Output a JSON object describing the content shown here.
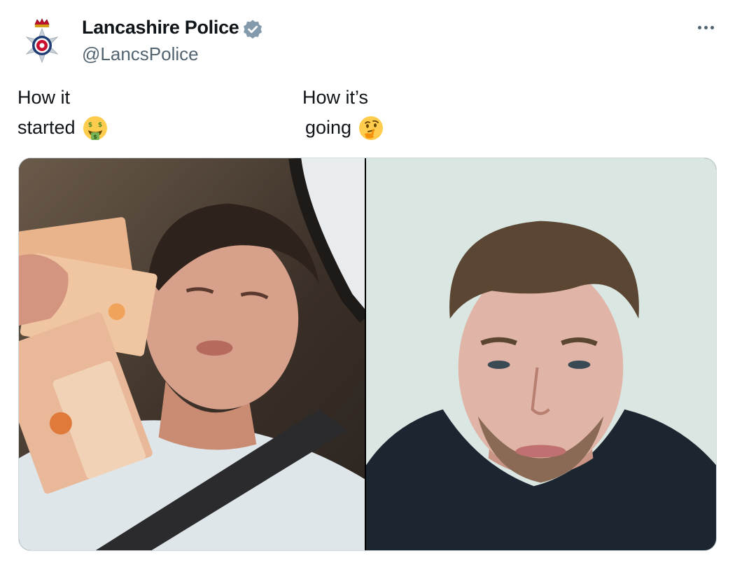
{
  "tweet": {
    "author_name": "Lancashire Police",
    "author_handle": "@LancsPolice",
    "verified": true,
    "caption_left": {
      "line1": "How it",
      "line2": "started",
      "emoji": "money-mouth-face"
    },
    "caption_right": {
      "line1": "How it’s",
      "line2": "going",
      "emoji": "thinking-face"
    },
    "media": [
      {
        "name": "selfie-with-banknotes"
      },
      {
        "name": "custody-mugshot"
      }
    ]
  },
  "colors": {
    "text": "#0f1419",
    "secondary": "#536471",
    "verified": "#829aab",
    "border": "#cfd9de"
  }
}
